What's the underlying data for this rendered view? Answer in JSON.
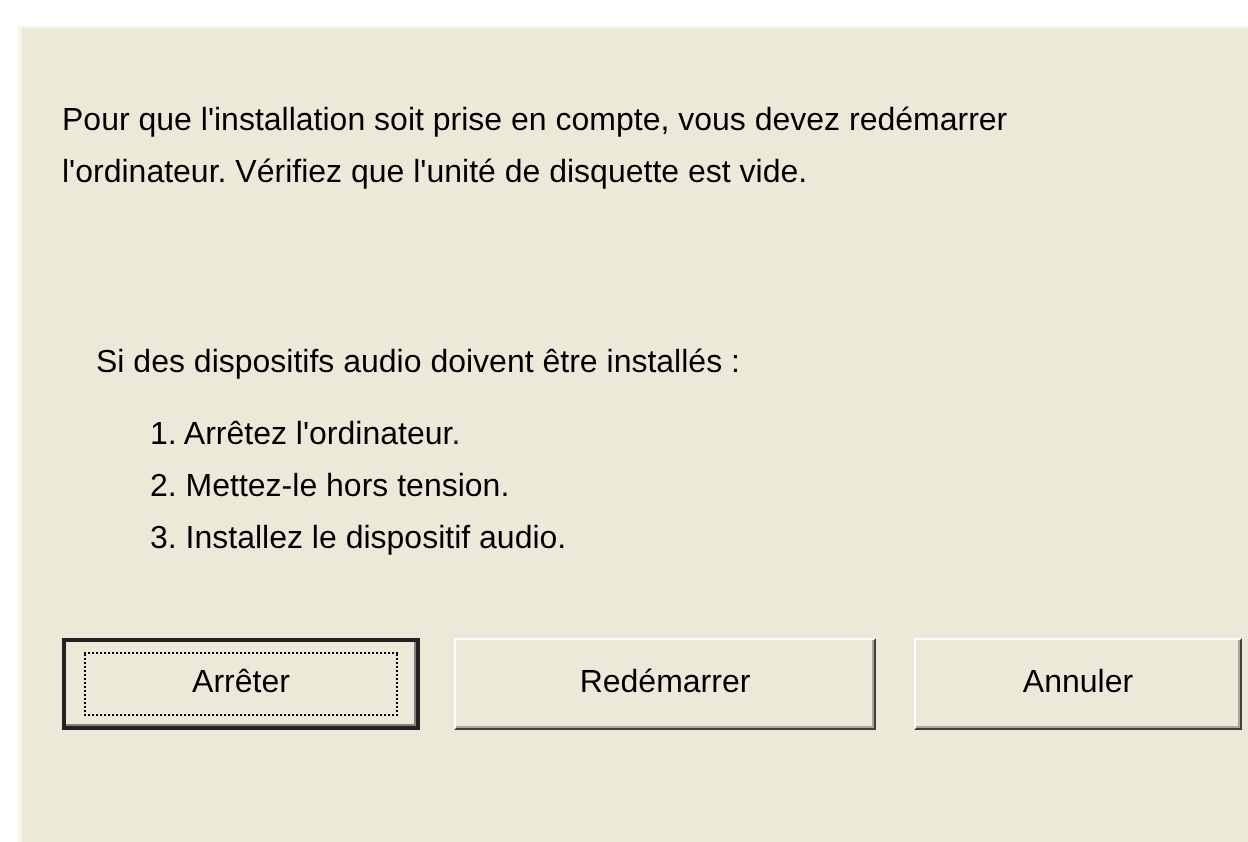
{
  "message": "Pour que l'installation soit prise en compte, vous devez redémarrer l'ordinateur. Vérifiez que l'unité de disquette est vide.",
  "audio_intro": "Si des dispositifs audio doivent être installés :",
  "steps": [
    "1. Arrêtez l'ordinateur.",
    "2. Mettez-le hors tension.",
    "3. Installez le dispositif audio."
  ],
  "buttons": [
    {
      "label": "Arrêter",
      "default": true
    },
    {
      "label": "Redémarrer",
      "default": false
    },
    {
      "label": "Annuler",
      "default": false
    }
  ]
}
